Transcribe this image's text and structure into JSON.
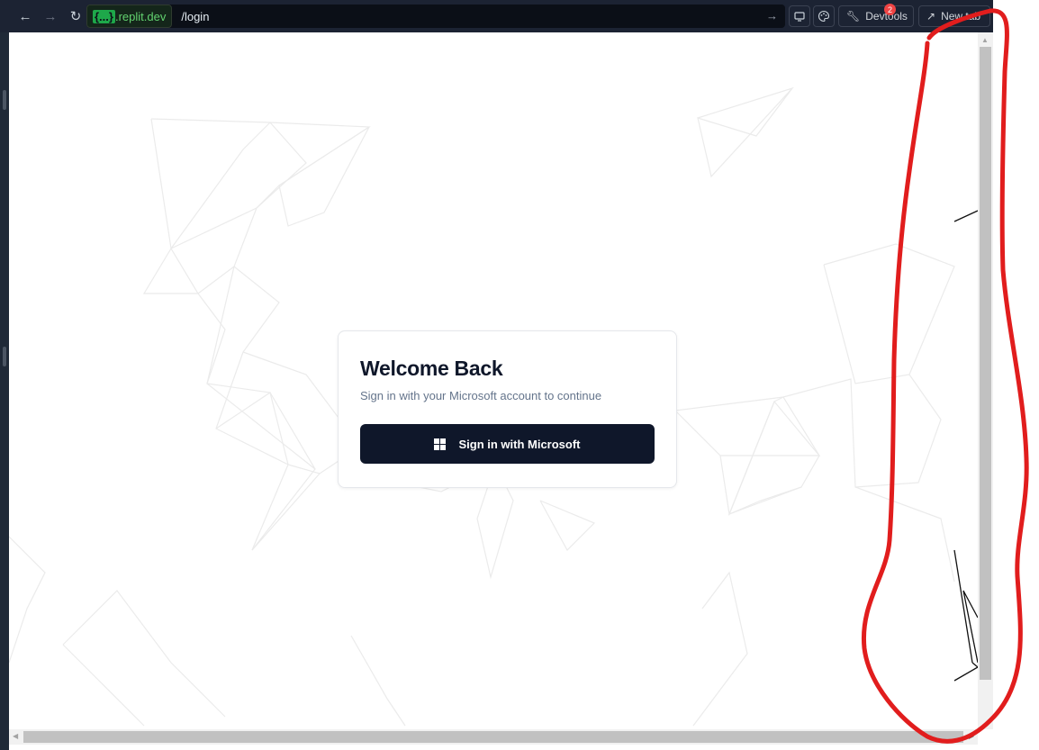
{
  "browser": {
    "url_domain_prefix": "{...}",
    "url_domain_suffix": ".replit.dev",
    "url_path": "/login",
    "devtools_label": "Devtools",
    "devtools_badge": "2",
    "new_tab_label": "New tab"
  },
  "icons": {
    "back": "arrow-left-icon",
    "forward": "arrow-right-icon",
    "reload": "reload-icon",
    "go": "arrow-right-icon",
    "screen": "monitor-icon",
    "theme": "palette-icon",
    "devtools": "wrench-icon",
    "new_tab": "external-link-icon",
    "signin": "windows-logo-icon"
  },
  "login": {
    "title": "Welcome Back",
    "subtitle": "Sign in with your Microsoft account to continue",
    "button_label": "Sign in with Microsoft"
  },
  "colors": {
    "toolbar_bg": "#1c2333",
    "domain_green": "#62d26f",
    "button_bg": "#0f172a",
    "annotation_red": "#e11d1d",
    "badge_red": "#ef4444"
  }
}
